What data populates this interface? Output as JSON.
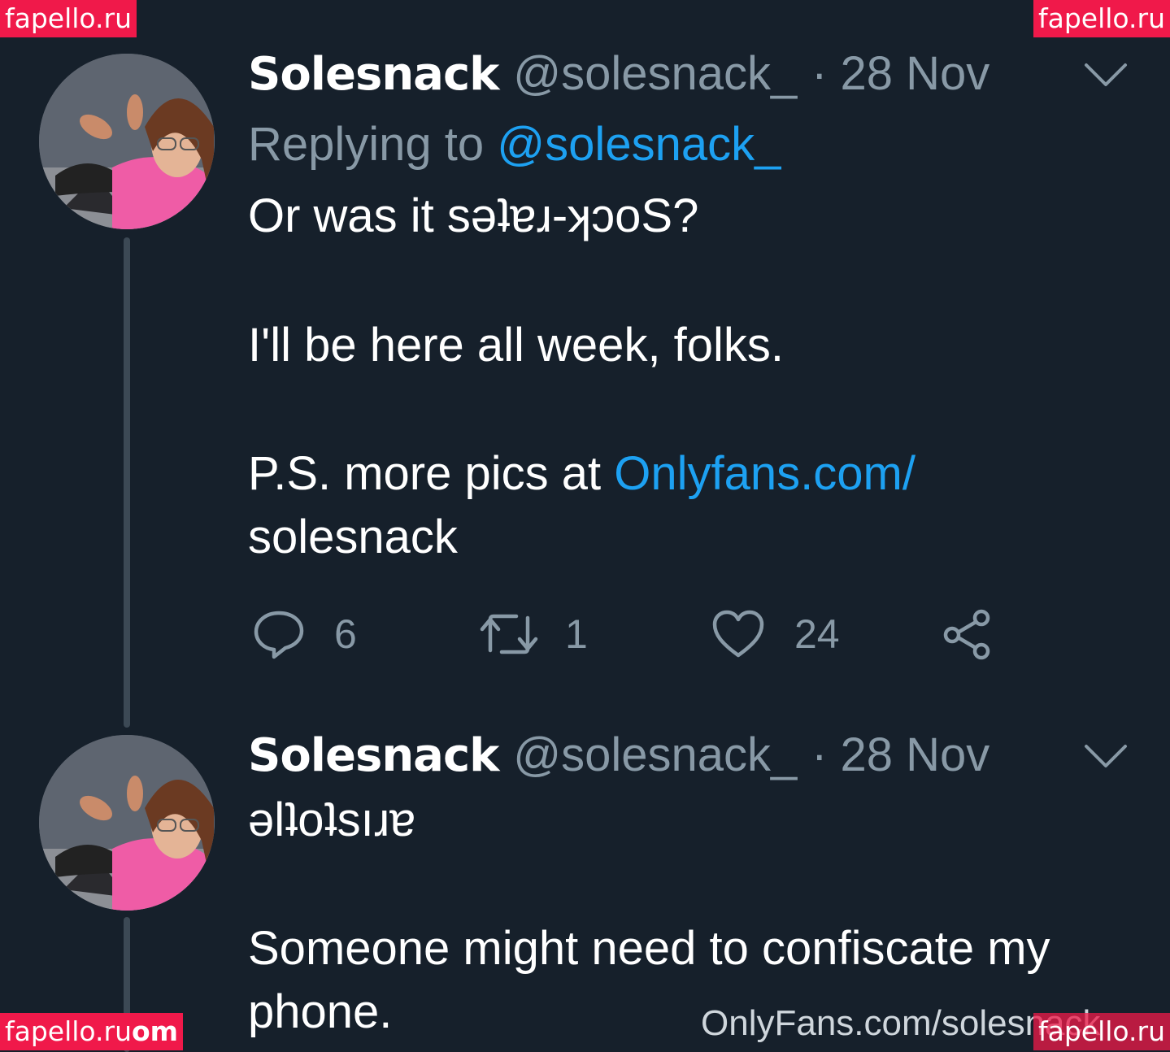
{
  "watermarks": {
    "top_left": "fapello.ru",
    "top_right": "fapello.ru",
    "bottom_left": "fapello.ru",
    "bottom_left_trail": "om",
    "bottom_right": "fapello.ru"
  },
  "bottom_url": "OnlyFans.com/solesnack",
  "colors": {
    "background": "#16202b",
    "muted_text": "#8899a6",
    "link": "#1da1f2",
    "watermark": "#f0194a"
  },
  "tweets": [
    {
      "name": "Solesnack",
      "handle": "@solesnack_",
      "date": "· 28 Nov",
      "replying_label": "Replying to",
      "replying_handle": "@solesnack_",
      "lines": {
        "line1": "Or was it sǝʇɐɹ-ʞɔoS?",
        "line2": "I'll be here all week, folks.",
        "line3_prefix": "P.S. more pics at ",
        "line3_link": "Onlyfans.com/",
        "line4_link": "solesnack"
      },
      "actions": {
        "reply_icon": "reply-icon",
        "reply_count": "6",
        "retweet_icon": "retweet-icon",
        "retweet_count": "1",
        "like_icon": "heart-icon",
        "like_count": "24",
        "share_icon": "share-icon"
      }
    },
    {
      "name": "Solesnack",
      "handle": "@solesnack_",
      "date": "· 28 Nov",
      "lines": {
        "line1": "ǝlʇoʇsıɹɐ",
        "line2": "Someone might need to confiscate my",
        "line3": "phone."
      }
    }
  ]
}
